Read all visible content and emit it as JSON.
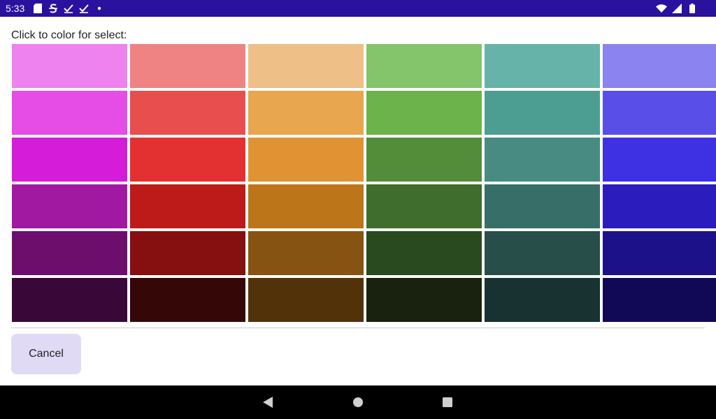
{
  "status_bar": {
    "time": "5:33",
    "notification_icons": [
      "sd-card-icon",
      "s-logo-icon",
      "checkmark-icon",
      "checkmark-icon",
      "dot-icon"
    ],
    "system_icons": [
      "wifi-icon",
      "cell-signal-icon",
      "battery-icon"
    ],
    "background": "#2a119e"
  },
  "dialog": {
    "prompt": "Click to color for select:",
    "cancel_label": "Cancel",
    "cancel_color": "#e0daf5"
  },
  "swatch_rows": [
    [
      "#ee82ee",
      "#ef8383",
      "#eebf86",
      "#84c46a",
      "#66b3aa",
      "#8b83ef"
    ],
    [
      "#e64ce6",
      "#e84e4e",
      "#e8a64f",
      "#6bb34a",
      "#4c9e92",
      "#594ee8"
    ],
    [
      "#d41cd9",
      "#e33131",
      "#e19333",
      "#538d3a",
      "#478b82",
      "#3d31e3"
    ],
    [
      "#a118a1",
      "#bd1a1a",
      "#bd751a",
      "#3f6d2e",
      "#376e68",
      "#2a1cbd"
    ],
    [
      "#6d0e6d",
      "#860f0f",
      "#875312",
      "#294a1e",
      "#284e4a",
      "#1c1189"
    ],
    [
      "#390738",
      "#360707",
      "#523209",
      "#18220e",
      "#183131",
      "#120956"
    ]
  ],
  "nav_bar": {
    "buttons": [
      "back-icon",
      "home-icon",
      "recents-icon"
    ]
  }
}
